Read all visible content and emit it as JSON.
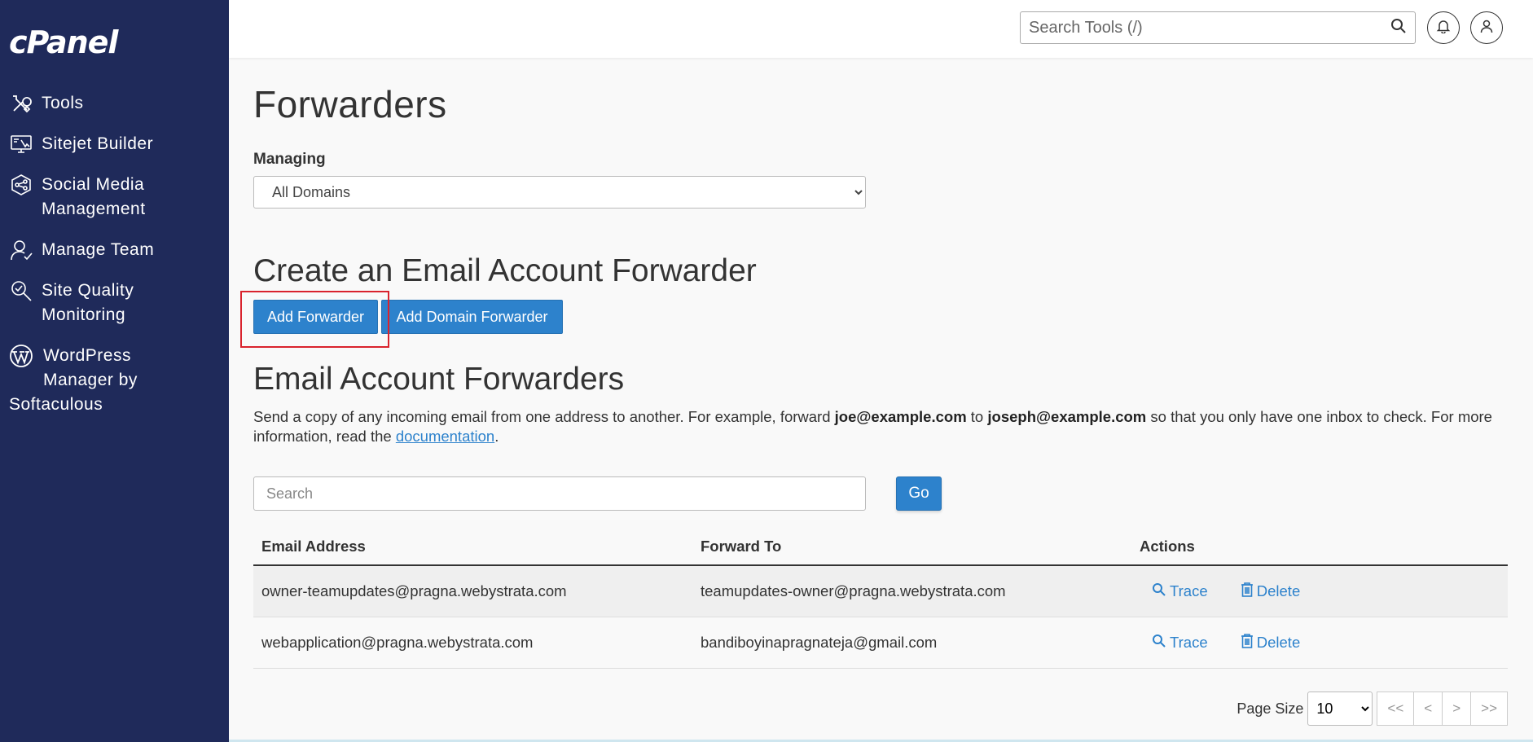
{
  "brand": {
    "logo_text": "cPanel"
  },
  "sidebar": {
    "items": [
      {
        "label": "Tools",
        "icon": "tools-icon"
      },
      {
        "label": "Sitejet Builder",
        "icon": "sitejet-icon"
      },
      {
        "label": "Social Media Management",
        "line1": "Social Media",
        "line2": "Management",
        "icon": "social-media-icon"
      },
      {
        "label": "Manage Team",
        "icon": "manage-team-icon"
      },
      {
        "label": "Site Quality Monitoring",
        "line1": "Site Quality",
        "line2": "Monitoring",
        "icon": "site-quality-icon"
      },
      {
        "label": "WordPress Manager by Softaculous",
        "line1": "WordPress",
        "line2": "Manager by",
        "line3": "Softaculous",
        "icon": "wordpress-icon"
      }
    ]
  },
  "header": {
    "search_placeholder": "Search Tools (/)",
    "notifications_icon": "bell-icon",
    "user_icon": "user-icon"
  },
  "main": {
    "title": "Forwarders",
    "managing_label": "Managing",
    "managing_selected": "All Domains",
    "create_heading": "Create an Email Account Forwarder",
    "add_forwarder_label": "Add Forwarder",
    "add_domain_forwarder_label": "Add Domain Forwarder",
    "list_heading": "Email Account Forwarders",
    "desc_part1": "Send a copy of any incoming email from one address to another. For example, forward ",
    "desc_bold1": "joe@example.com",
    "desc_part2": " to ",
    "desc_bold2": "joseph@example.com",
    "desc_part3": " so that you only have one inbox to check. For more information, read the ",
    "desc_link": "documentation",
    "desc_part4": ".",
    "search_placeholder": "Search",
    "go_label": "Go"
  },
  "table": {
    "headers": [
      "Email Address",
      "Forward To",
      "Actions"
    ],
    "rows": [
      {
        "email": "owner-teamupdates@pragna.webystrata.com",
        "forward_to": "teamupdates-owner@pragna.webystrata.com",
        "trace": "Trace",
        "delete": "Delete"
      },
      {
        "email": "webapplication@pragna.webystrata.com",
        "forward_to": "bandiboyinapragnateja@gmail.com",
        "trace": "Trace",
        "delete": "Delete"
      }
    ]
  },
  "pager": {
    "page_size_label": "Page Size",
    "page_size_value": "10",
    "first": "<<",
    "prev": "<",
    "next": ">",
    "last": ">>"
  },
  "colors": {
    "sidebar": "#1f2a5a",
    "primary": "#2d82cc",
    "highlight": "#d9232d"
  }
}
